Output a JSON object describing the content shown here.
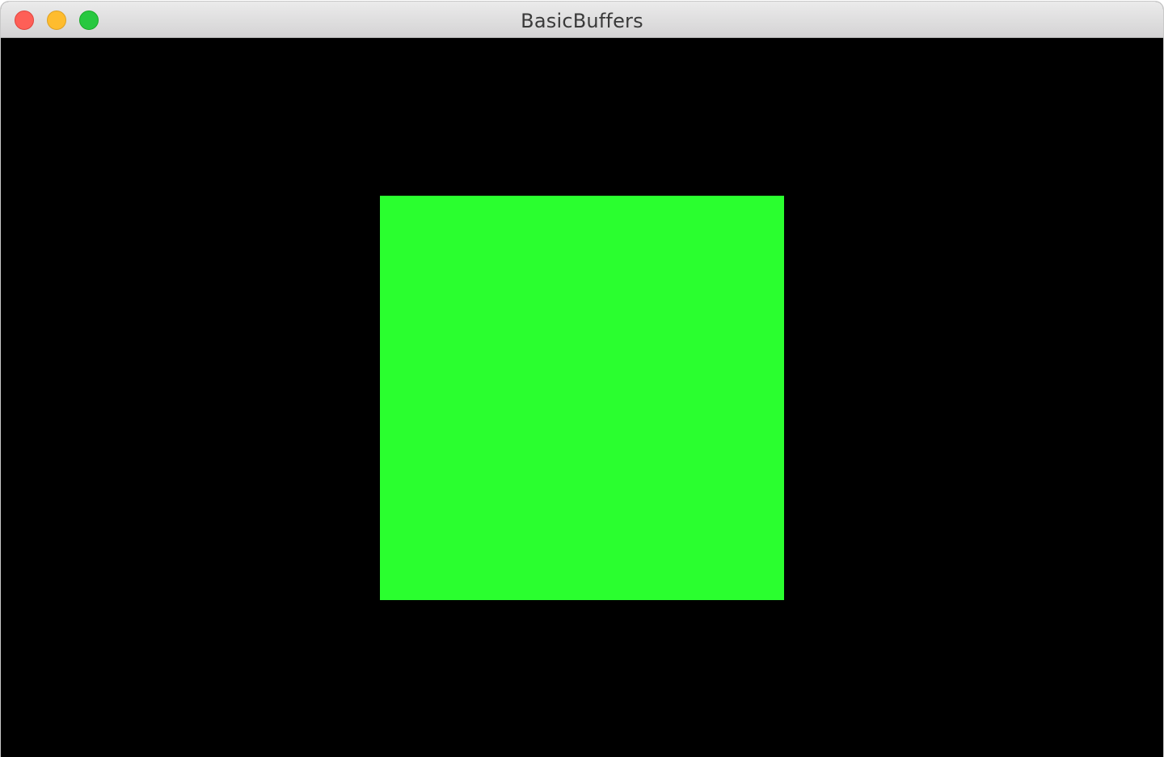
{
  "window": {
    "title": "BasicBuffers",
    "controls": {
      "close": {
        "icon": "close-icon",
        "color": "#fe5f57"
      },
      "minimize": {
        "icon": "minimize-icon",
        "color": "#febc2e"
      },
      "zoom": {
        "icon": "zoom-icon",
        "color": "#28c840"
      }
    }
  },
  "render": {
    "clear_color": "#000000",
    "quad_color": "#2aff2f"
  }
}
